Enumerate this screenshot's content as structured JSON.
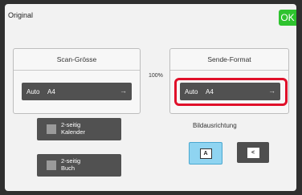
{
  "header": {
    "title": "Original",
    "ok_label": "OK"
  },
  "scan_size": {
    "title": "Scan-Grösse",
    "mode": "Auto",
    "size": "A4"
  },
  "ratio": "100%",
  "send_format": {
    "title": "Sende-Format",
    "mode": "Auto",
    "size": "A4"
  },
  "duplex_buttons": [
    {
      "line1": "2-seitig",
      "line2": "Kalender"
    },
    {
      "line1": "2-seitig",
      "line2": "Buch"
    }
  ],
  "orientation": {
    "label": "Bildausrichtung",
    "options": [
      "A",
      "<"
    ],
    "selected_index": 0
  },
  "colors": {
    "ok": "#2ec32e",
    "highlight": "#e0102a",
    "selected": "#8fd4f1"
  }
}
